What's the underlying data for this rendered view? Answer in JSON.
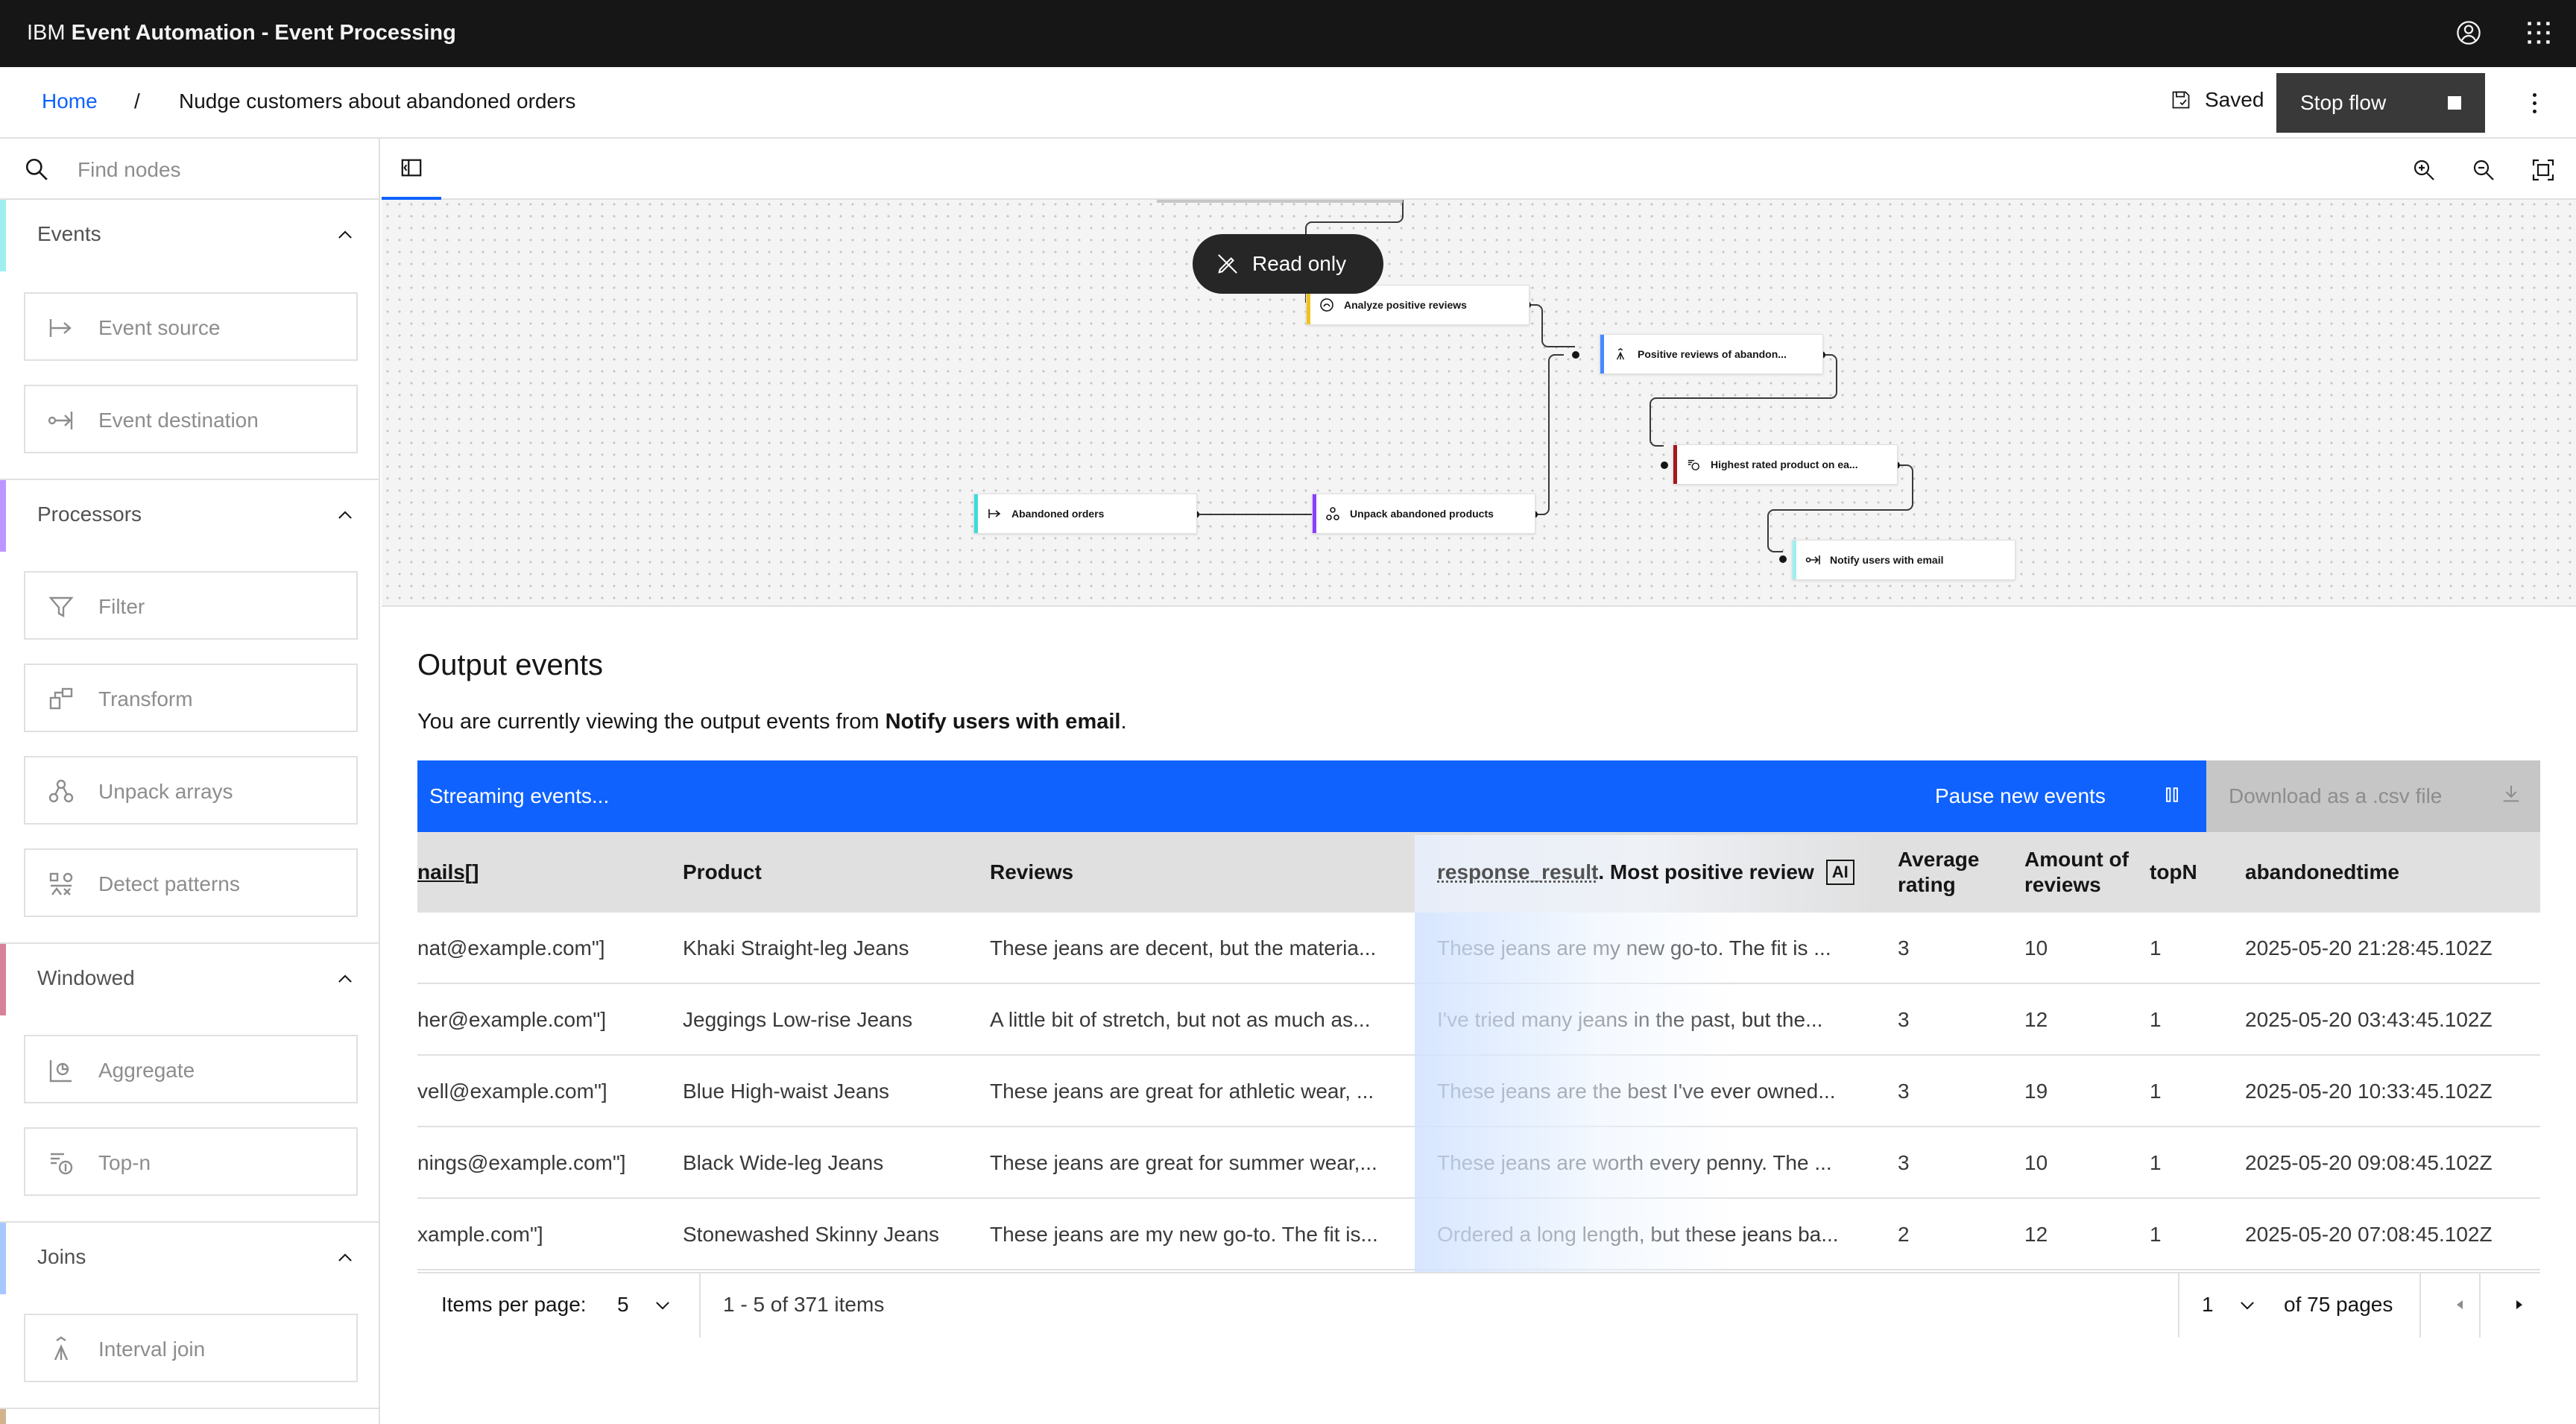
{
  "topbar": {
    "brand_prefix": "IBM",
    "brand_name": "Event Automation - Event Processing"
  },
  "breadcrumb": {
    "home": "Home",
    "separator": "/",
    "current": "Nudge customers about abandoned orders"
  },
  "actions": {
    "saved": "Saved",
    "stop_flow": "Stop flow"
  },
  "search": {
    "placeholder": "Find nodes"
  },
  "sidebar": {
    "events": {
      "label": "Events",
      "color": "#9ef0f0",
      "items": [
        "Event source",
        "Event destination"
      ]
    },
    "processors": {
      "label": "Processors",
      "color": "#be95ff",
      "items": [
        "Filter",
        "Transform",
        "Unpack arrays",
        "Detect patterns"
      ]
    },
    "windowed": {
      "label": "Windowed",
      "color": "#d8829a",
      "items": [
        "Aggregate",
        "Top-n"
      ]
    },
    "joins": {
      "label": "Joins",
      "color": "#a6c8ff",
      "items": [
        "Interval join"
      ]
    }
  },
  "canvas": {
    "read_only": "Read only",
    "nodes": {
      "analyze": "Analyze positive reviews",
      "positive": "Positive reviews of abandon...",
      "highest": "Highest rated product on ea...",
      "abandoned": "Abandoned orders",
      "unpack": "Unpack abandoned products",
      "notify": "Notify users with email"
    }
  },
  "output": {
    "title": "Output events",
    "desc_prefix": "You are currently viewing the output events from ",
    "desc_node": "Notify users with email",
    "desc_suffix": ".",
    "streaming": "Streaming events...",
    "pause": "Pause new events",
    "download": "Download as a .csv file"
  },
  "table": {
    "headers": {
      "emails": "nails[]",
      "product": "Product",
      "reviews": "Reviews",
      "ai_prefix": "response_result",
      "ai_name": ". Most positive review",
      "ai_badge": "AI",
      "avg": "Average rating",
      "amount": "Amount of reviews",
      "topn": "topN",
      "time": "abandonedtime"
    },
    "rows": [
      {
        "emails": "nat@example.com\"]",
        "product": "Khaki Straight-leg Jeans",
        "reviews": "These jeans are decent, but the materia...",
        "ai": "These jeans are my new go-to. The fit is ...",
        "avg": "3",
        "amount": "10",
        "topn": "1",
        "time": "2025-05-20 21:28:45.102Z"
      },
      {
        "emails": "her@example.com\"]",
        "product": "Jeggings Low-rise Jeans",
        "reviews": "A little bit of stretch, but not as much as...",
        "ai": "I've tried many jeans in the past, but the...",
        "avg": "3",
        "amount": "12",
        "topn": "1",
        "time": "2025-05-20 03:43:45.102Z"
      },
      {
        "emails": "vell@example.com\"]",
        "product": "Blue High-waist Jeans",
        "reviews": "These jeans are great for athletic wear, ...",
        "ai": "These jeans are the best I've ever owned...",
        "avg": "3",
        "amount": "19",
        "topn": "1",
        "time": "2025-05-20 10:33:45.102Z"
      },
      {
        "emails": "nings@example.com\"]",
        "product": "Black Wide-leg Jeans",
        "reviews": "These jeans are great for summer wear,...",
        "ai": "These jeans are worth every penny. The ...",
        "avg": "3",
        "amount": "10",
        "topn": "1",
        "time": "2025-05-20 09:08:45.102Z"
      },
      {
        "emails": "xample.com\"]",
        "product": "Stonewashed Skinny Jeans",
        "reviews": "These jeans are my new go-to. The fit is...",
        "ai": "Ordered a long length, but these jeans ba...",
        "avg": "2",
        "amount": "12",
        "topn": "1",
        "time": "2025-05-20 07:08:45.102Z"
      }
    ]
  },
  "pager": {
    "items_label": "Items per page:",
    "items_value": "5",
    "range": "1 - 5 of 371 items",
    "page": "1",
    "of_pages": "of 75 pages"
  }
}
